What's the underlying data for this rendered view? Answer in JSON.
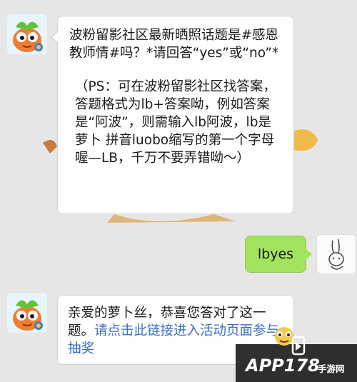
{
  "messages": [
    {
      "sender": "bot",
      "line1": "波粉留影社区最新晒照话题是#感恩教师情#吗？*请回答“yes”或“no”*",
      "line2": "（PS：可在波粉留影社区找答案，答题格式为lb+答案呦，例如答案是“阿波”，则需输入lb阿波，lb是萝卜 拼音luobo缩写的第一个字母喔—LB，千万不要弄错呦～）"
    },
    {
      "sender": "user",
      "text": "lbyes"
    },
    {
      "sender": "bot",
      "text": "亲爱的萝卜丝，恭喜您答对了这一题。",
      "link_text": "请点击此链接进入活动页面参与抽奖"
    }
  ],
  "watermark": {
    "brand": "APP178",
    "sub": "手游网"
  },
  "colors": {
    "background": "#e6e6e6",
    "user_bubble": "#a3e45e",
    "link": "#3a6fc9"
  }
}
